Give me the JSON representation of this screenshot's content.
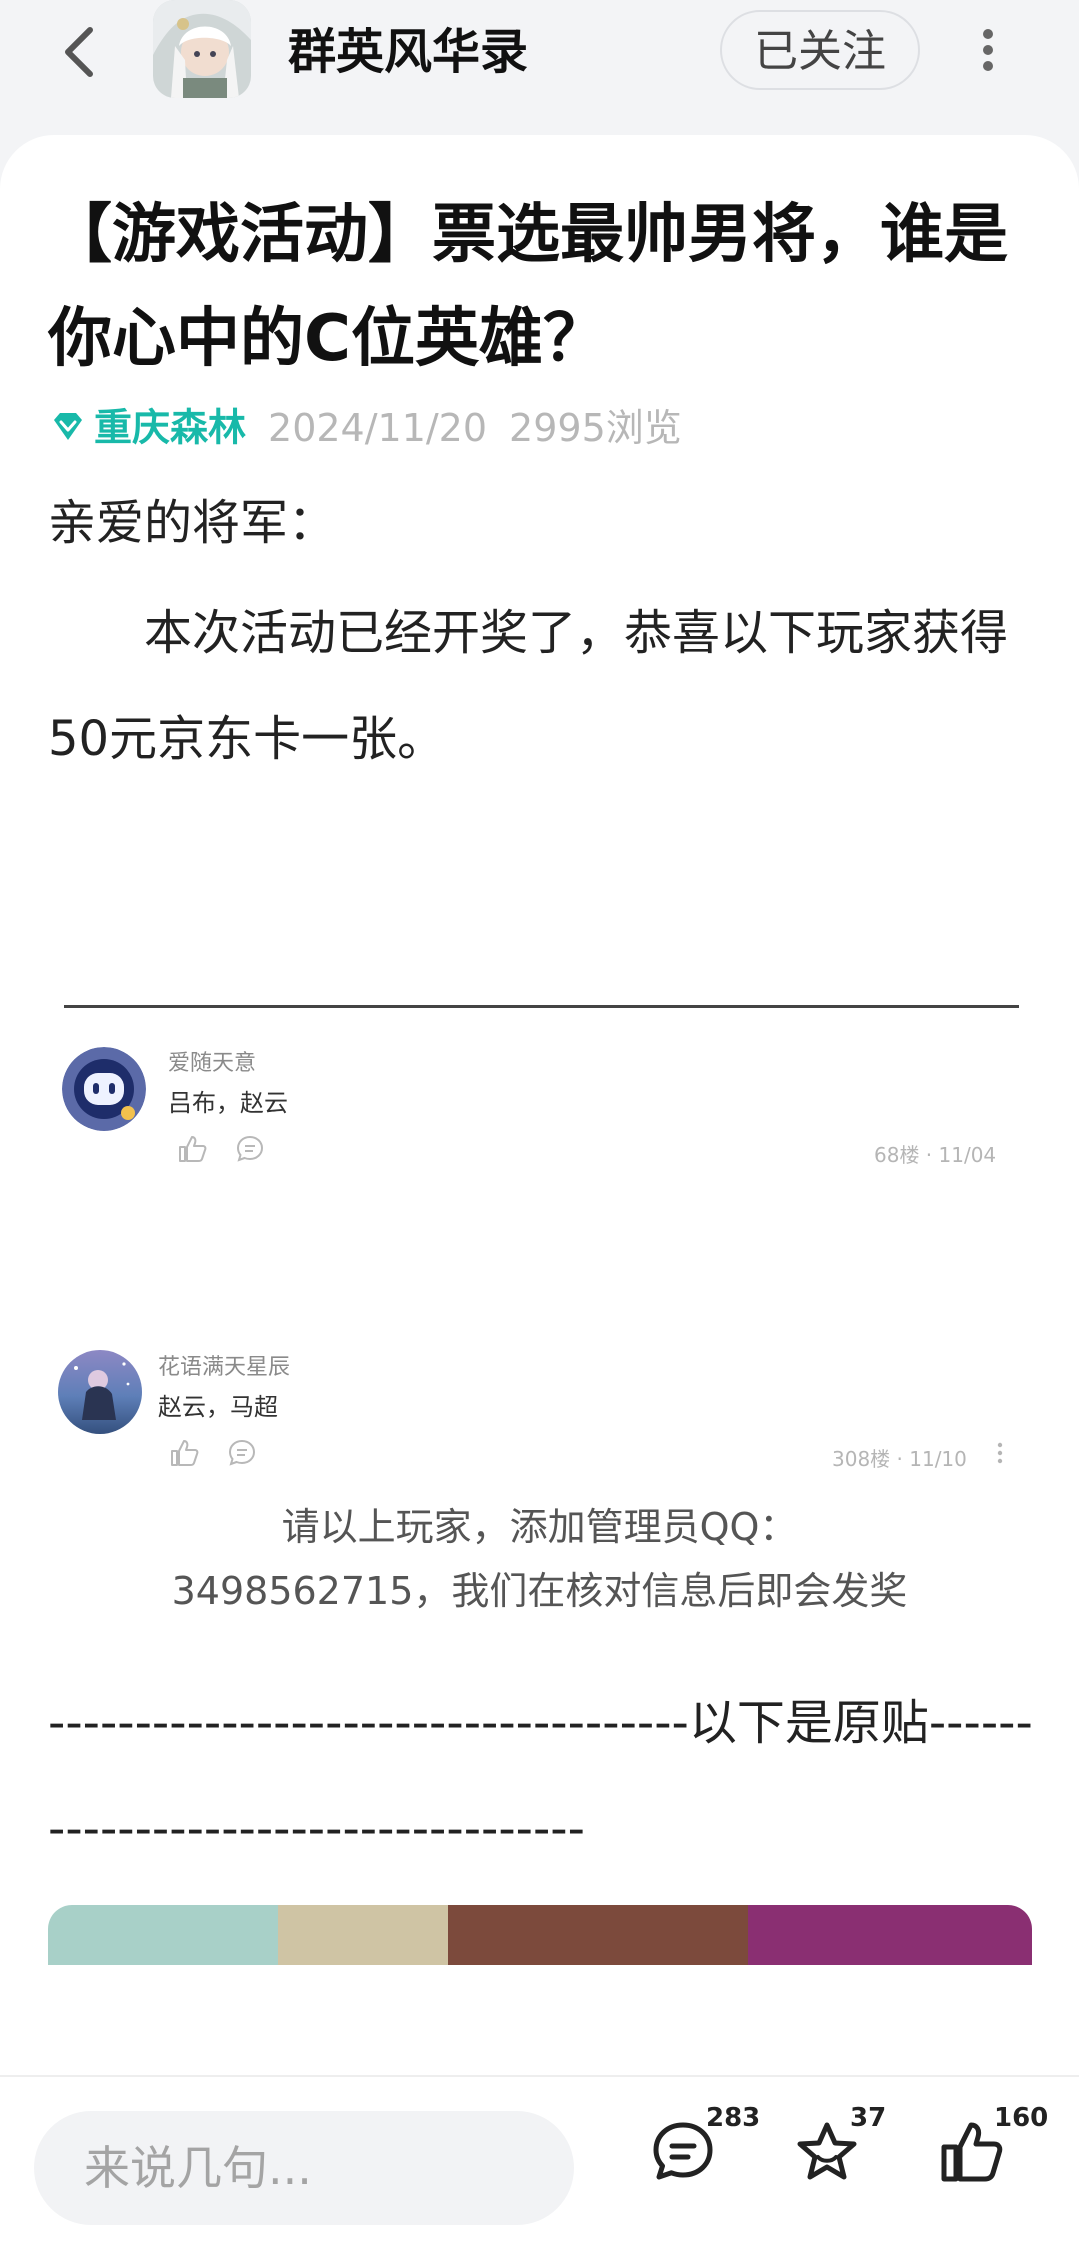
{
  "header": {
    "back_icon": "chevron-left-icon",
    "app_title": "群英风华录",
    "follow_label": "已关注",
    "more_icon": "vertical-dots-icon"
  },
  "post": {
    "title": "【游戏活动】票选最帅男将，谁是你心中的C位英雄？",
    "author": "重庆森林",
    "date": "2024/11/20",
    "views": "2995浏览",
    "greeting": "亲爱的将军：",
    "body": "本次活动已经开奖了，恭喜以下玩家获得50元京东卡一张。",
    "note_line1": "请以上玩家，添加管理员QQ：",
    "note_line2": "3498562715，我们在核对信息后即会发奖",
    "divider_text": "-------------------------------------以下是原贴-------------------------------------"
  },
  "winners": [
    {
      "name": "爱随天意",
      "text": "吕布，赵云",
      "floor": "68楼 · 11/04"
    },
    {
      "name": "花语满天星辰",
      "text": "赵云，马超",
      "floor": "308楼 · 11/10"
    }
  ],
  "bottom": {
    "comment_placeholder": "来说几句...",
    "comments_count": "283",
    "favorites_count": "37",
    "likes_count": "160"
  },
  "colors": {
    "accent": "#18b9a9",
    "background": "#f3f4f6"
  }
}
